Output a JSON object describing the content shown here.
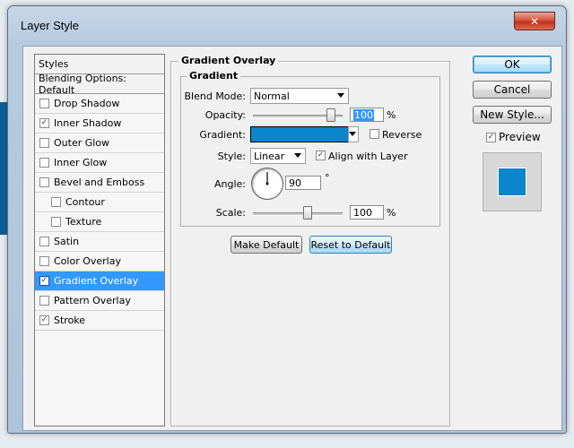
{
  "window": {
    "title": "Layer Style",
    "close_symbol": "✕"
  },
  "styles_list": {
    "header": "Styles",
    "blending": "Blending Options: Default",
    "items": [
      {
        "label": "Drop Shadow",
        "checked": false,
        "sub": false,
        "selected": false
      },
      {
        "label": "Inner Shadow",
        "checked": true,
        "sub": false,
        "selected": false
      },
      {
        "label": "Outer Glow",
        "checked": false,
        "sub": false,
        "selected": false
      },
      {
        "label": "Inner Glow",
        "checked": false,
        "sub": false,
        "selected": false
      },
      {
        "label": "Bevel and Emboss",
        "checked": false,
        "sub": false,
        "selected": false
      },
      {
        "label": "Contour",
        "checked": false,
        "sub": true,
        "selected": false
      },
      {
        "label": "Texture",
        "checked": false,
        "sub": true,
        "selected": false
      },
      {
        "label": "Satin",
        "checked": false,
        "sub": false,
        "selected": false
      },
      {
        "label": "Color Overlay",
        "checked": false,
        "sub": false,
        "selected": false
      },
      {
        "label": "Gradient Overlay",
        "checked": true,
        "sub": false,
        "selected": true
      },
      {
        "label": "Pattern Overlay",
        "checked": false,
        "sub": false,
        "selected": false
      },
      {
        "label": "Stroke",
        "checked": true,
        "sub": false,
        "selected": false
      }
    ]
  },
  "gradient_overlay": {
    "group_title": "Gradient Overlay",
    "inner_title": "Gradient",
    "blend_mode_label": "Blend Mode:",
    "blend_mode_value": "Normal",
    "opacity_label": "Opacity:",
    "opacity_value": "100",
    "opacity_unit": "%",
    "gradient_label": "Gradient:",
    "gradient_color": "#0b85cc",
    "reverse_label": "Reverse",
    "reverse_checked": false,
    "style_label": "Style:",
    "style_value": "Linear",
    "align_label": "Align with Layer",
    "align_checked": true,
    "angle_label": "Angle:",
    "angle_value": "90",
    "angle_unit": "°",
    "scale_label": "Scale:",
    "scale_value": "100",
    "scale_unit": "%",
    "make_default": "Make Default",
    "reset_default": "Reset to Default"
  },
  "actions": {
    "ok": "OK",
    "cancel": "Cancel",
    "new_style": "New Style...",
    "preview_label": "Preview",
    "preview_checked": true,
    "preview_color": "#0b85cc"
  }
}
